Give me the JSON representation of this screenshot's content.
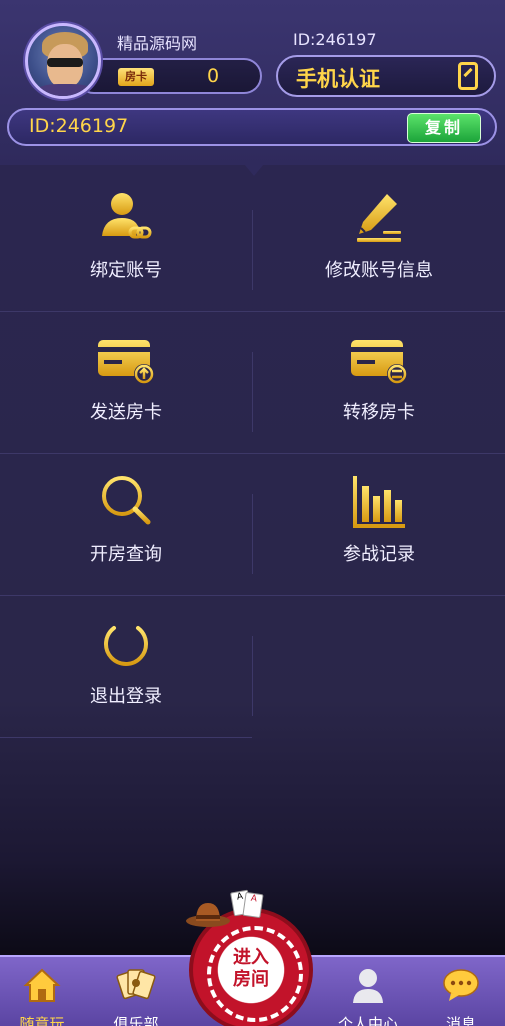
{
  "header": {
    "nickname": "精品源码网",
    "user_id_label": "ID:246197",
    "card_badge": "房卡",
    "card_count": "0",
    "phone_verify_label": "手机认证",
    "id_bar_text": "ID:246197",
    "copy_label": "复制"
  },
  "menu": {
    "items": [
      {
        "label": "绑定账号",
        "icon": "user-link-icon"
      },
      {
        "label": "修改账号信息",
        "icon": "edit-pen-icon"
      },
      {
        "label": "发送房卡",
        "icon": "card-send-icon"
      },
      {
        "label": "转移房卡",
        "icon": "card-transfer-icon"
      },
      {
        "label": "开房查询",
        "icon": "search-icon"
      },
      {
        "label": "参战记录",
        "icon": "bar-chart-icon"
      },
      {
        "label": "退出登录",
        "icon": "power-icon"
      }
    ]
  },
  "bottom_nav": {
    "items": [
      {
        "label": "随意玩",
        "icon": "home-icon",
        "active": true
      },
      {
        "label": "俱乐部",
        "icon": "cards-icon"
      },
      {
        "label": "个人中心",
        "icon": "user-icon"
      },
      {
        "label": "消息",
        "icon": "chat-icon"
      }
    ],
    "center_button": "进入房间"
  },
  "colors": {
    "accent_gold": "#ffd54a",
    "background": "#2a2649",
    "copy_green": "#1ca43a",
    "chip_red": "#c2132a"
  }
}
